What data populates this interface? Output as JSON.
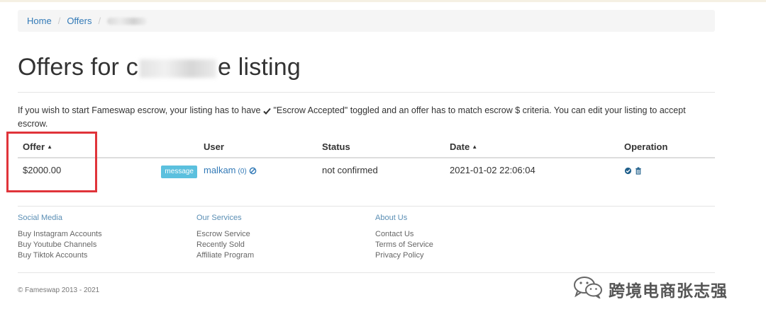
{
  "breadcrumb": {
    "items": [
      "Home",
      "Offers"
    ],
    "separator": "/"
  },
  "page": {
    "title_start": "Offers for c",
    "title_end": "e listing"
  },
  "notice": {
    "before_icon": "If you wish to start Fameswap escrow, your listing has to have",
    "icon": "check-icon",
    "after_icon": "\"Escrow Accepted\" toggled and an offer has to match escrow $ criteria. You can edit your listing to accept escrow."
  },
  "table": {
    "headers": {
      "offer": "Offer",
      "user": "User",
      "status": "Status",
      "date": "Date",
      "operation": "Operation"
    },
    "rows": [
      {
        "offer": "$2000.00",
        "message_label": "message",
        "user": "malkam",
        "user_count": "(0)",
        "status": "not confirmed",
        "date": "2021-01-02 22:06:04"
      }
    ]
  },
  "footer": {
    "social": {
      "title": "Social Media",
      "links": [
        "Buy Instagram Accounts",
        "Buy Youtube Channels",
        "Buy Tiktok Accounts"
      ]
    },
    "services": {
      "title": "Our Services",
      "links": [
        "Escrow Service",
        "Recently Sold",
        "Affiliate Program"
      ]
    },
    "about": {
      "title": "About Us",
      "links": [
        "Contact Us",
        "Terms of Service",
        "Privacy Policy"
      ]
    },
    "copyright": "© Fameswap 2013 - 2021"
  },
  "watermark": {
    "text": "跨境电商张志强",
    "icon": "wechat-icon"
  },
  "colors": {
    "link": "#337ab7",
    "badge": "#5bc0de",
    "highlight": "#e0343a"
  }
}
